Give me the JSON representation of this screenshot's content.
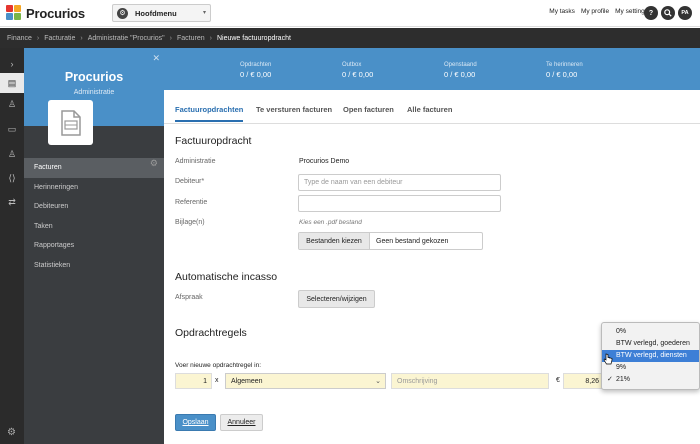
{
  "app": {
    "name": "Procurios",
    "brand_colors": [
      "#e5352f",
      "#f5a623",
      "#4a90c8",
      "#7ab648"
    ]
  },
  "mainmenu": {
    "label": "Hoofdmenu",
    "icon": "settings-icon"
  },
  "toplinks": [
    "My tasks",
    "My profile",
    "My settings"
  ],
  "topicons": {
    "help": "?",
    "search": "🔍",
    "avatar": "PA"
  },
  "breadcrumb": [
    "Finance",
    "Facturatie",
    "Administratie \"Procurios\"",
    "Facturen",
    "Nieuwe factuuropdracht"
  ],
  "leftpanel": {
    "title": "Procurios",
    "subtitle": "Administratie",
    "nav": [
      "Facturen",
      "Herinneringen",
      "Debiteuren",
      "Taken",
      "Rapportages",
      "Statistieken"
    ],
    "active": "Facturen"
  },
  "stats": [
    {
      "label": "Opdrachten",
      "value": "0 / € 0,00"
    },
    {
      "label": "Outbox",
      "value": "0 / € 0,00"
    },
    {
      "label": "Openstaand",
      "value": "0 / € 0,00"
    },
    {
      "label": "Te herinneren",
      "value": "0 / € 0,00"
    }
  ],
  "tabs": [
    "Factuuropdrachten",
    "Te versturen facturen",
    "Open facturen",
    "Alle facturen"
  ],
  "form": {
    "section1": "Factuuropdracht",
    "administratie_label": "Administratie",
    "administratie_value": "Procurios Demo",
    "debiteur_label": "Debiteur*",
    "debiteur_placeholder": "Type de naam van een debiteur",
    "referentie_label": "Referentie",
    "bijlagen_label": "Bijlage(n)",
    "bijlagen_hint": "Kies een .pdf bestand",
    "file_button": "Bestanden kiezen",
    "file_name": "Geen bestand gekozen",
    "section2": "Automatische incasso",
    "afspraak_label": "Afspraak",
    "afspraak_button": "Selecteren/wijzigen",
    "section3": "Opdrachtregels",
    "orderline_label": "Voer nieuwe opdrachtregel in:",
    "qty": "1",
    "times": "x",
    "category": "Algemeen",
    "description_placeholder": "Omschrijving",
    "currency": "€",
    "price": "8,26",
    "save": "Opslaan",
    "cancel": "Annuleer"
  },
  "vat_dropdown": {
    "options": [
      "0%",
      "BTW verlegd, goederen",
      "BTW verlegd, diensten",
      "9%",
      "21%"
    ],
    "highlighted": "BTW verlegd, diensten",
    "selected": "21%"
  }
}
